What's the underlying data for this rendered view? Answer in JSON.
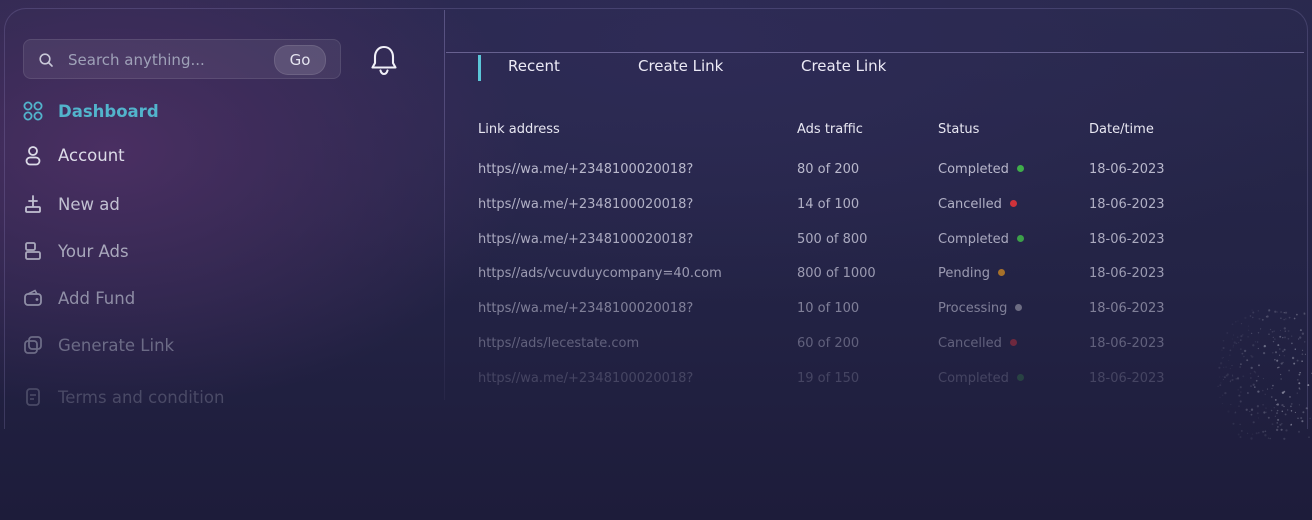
{
  "search": {
    "placeholder": "Search anything...",
    "go_label": "Go"
  },
  "sidebar": {
    "items": [
      {
        "label": "Dashboard",
        "icon": "grid-icon",
        "active": true
      },
      {
        "label": "Account",
        "icon": "user-icon"
      },
      {
        "label": "New ad",
        "icon": "upload-icon"
      },
      {
        "label": "Your Ads",
        "icon": "layout-icon"
      },
      {
        "label": "Add Fund",
        "icon": "wallet-icon"
      },
      {
        "label": "Generate Link",
        "icon": "link-copy-icon"
      },
      {
        "label": "Terms and condition",
        "icon": "document-icon"
      }
    ]
  },
  "tabs": [
    "Recent",
    "Create Link",
    "Create Link"
  ],
  "table": {
    "headers": [
      "Link address",
      "Ads traffic",
      "Status",
      "Date/time"
    ],
    "rows": [
      {
        "link": "https//wa.me/+2348100020018?",
        "traffic": "80 of 200",
        "status": "Completed",
        "date": "18-06-2023"
      },
      {
        "link": "https//wa.me/+2348100020018?",
        "traffic": "14 of 100",
        "status": "Cancelled",
        "date": "18-06-2023"
      },
      {
        "link": "https//wa.me/+2348100020018?",
        "traffic": "500 of 800",
        "status": "Completed",
        "date": "18-06-2023"
      },
      {
        "link": "https//ads/vcuvduycompany=40.com",
        "traffic": "800 of 1000",
        "status": "Pending",
        "date": "18-06-2023"
      },
      {
        "link": "https//wa.me/+2348100020018?",
        "traffic": "10 of 100",
        "status": "Processing",
        "date": "18-06-2023"
      },
      {
        "link": "https//ads/lecestate.com",
        "traffic": "60 of 200",
        "status": "Cancelled",
        "date": "18-06-2023"
      },
      {
        "link": "https//wa.me/+2348100020018?",
        "traffic": "19 of 150",
        "status": "Completed",
        "date": "18-06-2023"
      }
    ]
  },
  "colors": {
    "accent": "#4fb3c8",
    "completed": "#3fae4a",
    "cancelled": "#d8333a",
    "pending": "#c98524",
    "processing": "#9a9aa8"
  }
}
